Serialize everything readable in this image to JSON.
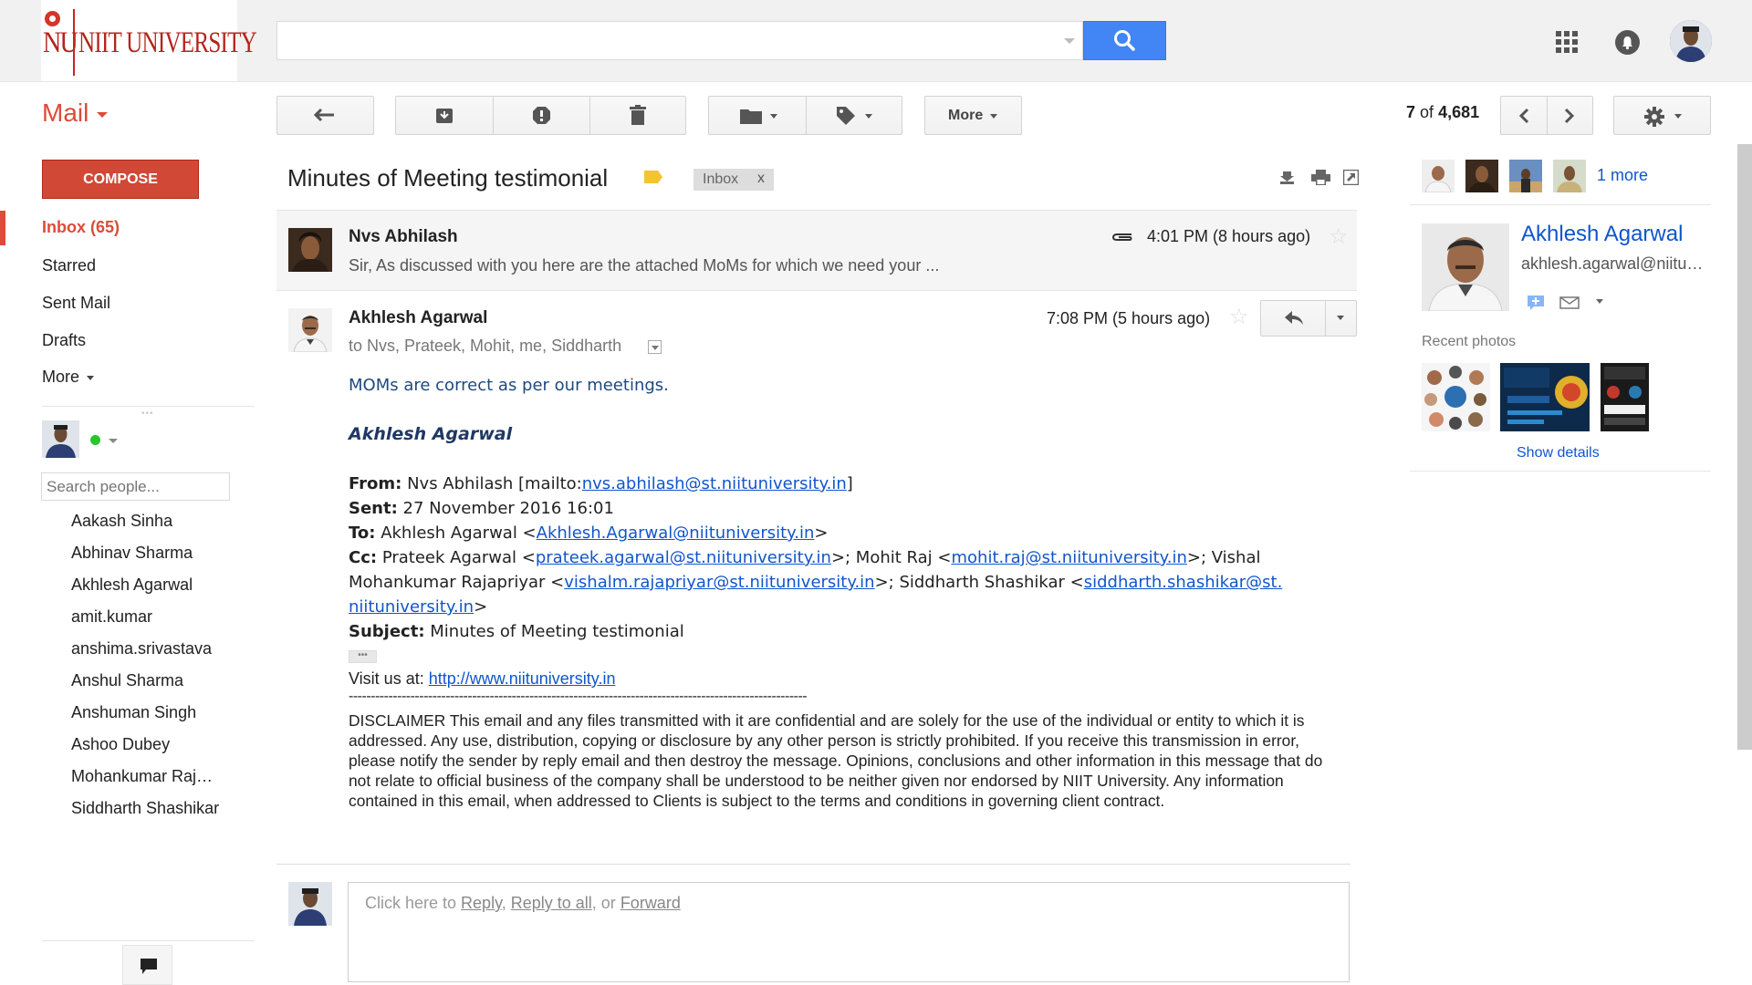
{
  "header": {
    "logo_mark": "NU",
    "logo_text": "NIIT UNIVERSITY",
    "search": {
      "value": "",
      "placeholder": ""
    }
  },
  "toolbar": {
    "app_label": "Mail",
    "more_label": "More",
    "count_current": "7",
    "count_of": "of",
    "count_total": "4,681"
  },
  "sidebar": {
    "compose_label": "COMPOSE",
    "items": [
      {
        "label": "Inbox (65)",
        "active": true
      },
      {
        "label": "Starred"
      },
      {
        "label": "Sent Mail"
      },
      {
        "label": "Drafts"
      },
      {
        "label": "More"
      }
    ],
    "people_search_placeholder": "Search people...",
    "contacts": [
      "Aakash Sinha",
      "Abhinav Sharma",
      "Akhlesh Agarwal",
      "amit.kumar",
      "anshima.srivastava",
      "Anshul Sharma",
      "Anshuman Singh",
      "Ashoo Dubey",
      "Mohankumar Raj…",
      "Siddharth Shashikar"
    ]
  },
  "thread": {
    "subject": "Minutes of Meeting testimonial",
    "label_chip": "Inbox",
    "label_chip_close": "x",
    "messages": [
      {
        "sender": "Nvs Abhilash",
        "time": "4:01 PM (8 hours ago)",
        "snippet": "Sir, As discussed with you here are the attached MoMs for which we need your ..."
      },
      {
        "sender": "Akhlesh Agarwal",
        "time": "7:08 PM (5 hours ago)",
        "to_line": "to Nvs, Prateek, Mohit, me, Siddharth",
        "body_line": "MOMs are correct as per our meetings.",
        "signature": "Akhlesh Agarwal",
        "quoted": {
          "from_label": "From:",
          "from_text": "Nvs Abhilash [mailto:",
          "from_link": "nvs.abhilash@st.niituniversity.in",
          "from_end": "]",
          "sent_label": "Sent:",
          "sent_text": "27 November 2016 16:01",
          "to_label": "To:",
          "to_text": "Akhlesh Agarwal <",
          "to_link": "Akhlesh.Agarwal@niituniversity.in",
          "to_end": ">",
          "cc_label": "Cc:",
          "cc_t1": "Prateek Agarwal <",
          "cc_l1": "prateek.agarwal@st.niituniversity.in",
          "cc_t2": ">; Mohit Raj <",
          "cc_l2": "mohit.raj@st.niituniversity.in",
          "cc_t3": ">; Vishal",
          "cc_t4": "Mohankumar Rajapriyar <",
          "cc_l3": "vishalm.rajapriyar@st.niituniversity.in",
          "cc_t5": ">; Siddharth Shashikar <",
          "cc_l4a": "siddharth.shashikar@st.",
          "cc_l4b": "niituniversity.in",
          "cc_t6": ">",
          "subject_label": "Subject:",
          "subject_text": "Minutes of Meeting testimonial"
        },
        "ellipsis": "•••",
        "visit_label": "Visit us at: ",
        "visit_link": "http://www.niituniversity.in",
        "dashes": "--------------------------------------------------------------------------------------------------------",
        "disclaimer": "DISCLAIMER This email and any files transmitted with it are confidential and are solely for the use of the individual or entity to which it is addressed. Any use, distribution, copying or disclosure by any other person is strictly prohibited. If you receive this transmission in error, please notify the sender by reply email and then destroy the message. Opinions, conclusions and other information in this message that do not relate to official business of the company shall be understood to be neither given nor endorsed by NIIT University. Any information contained in this email, when addressed to Clients is subject to the terms and conditions in governing client contract."
      }
    ],
    "quick_reply": {
      "prefix": "Click here to ",
      "reply": "Reply",
      "comma": ", ",
      "reply_all": "Reply to all",
      "or": ", or ",
      "forward": "Forward"
    }
  },
  "right_panel": {
    "more_people": "1 more",
    "profile_name": "Akhlesh Agarwal",
    "profile_email": "akhlesh.agarwal@niituniversity.in",
    "recent_photos_label": "Recent photos",
    "show_details": "Show details"
  },
  "colors": {
    "accent_red": "#dd4b39",
    "compose_red": "#d14836",
    "search_blue": "#4285f4",
    "link_blue": "#1155cc"
  }
}
